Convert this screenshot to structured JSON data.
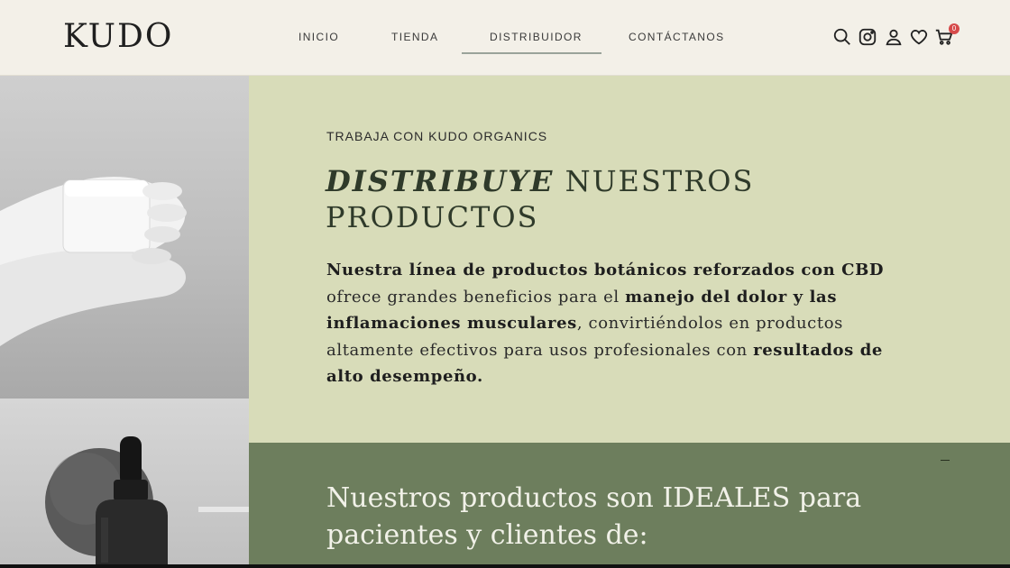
{
  "header": {
    "logo": "KUDO",
    "nav": [
      {
        "label": "INICIO"
      },
      {
        "label": "TIENDA"
      },
      {
        "label": "DISTRIBUIDOR"
      },
      {
        "label": "CONTÁCTANOS"
      }
    ],
    "icons": [
      "search-icon",
      "instagram-icon",
      "user-icon",
      "heart-icon",
      "cart-icon"
    ],
    "cart_count": "0"
  },
  "hero": {
    "eyebrow": "TRABAJA CON KUDO ORGANICS",
    "headline_em": "DISTRIBUYE",
    "headline_rest": " NUESTROS PRODUCTOS",
    "body": [
      {
        "text": "Nuestra línea de productos botánicos reforzados con CBD",
        "bold": true
      },
      {
        "text": " ofrece grandes beneficios para el ",
        "bold": false
      },
      {
        "text": "manejo del dolor y las inflamaciones musculares",
        "bold": true
      },
      {
        "text": ", convirtiéndolos en productos altamente efectivos para usos profesionales con ",
        "bold": false
      },
      {
        "text": "resultados de alto desempeño.",
        "bold": true
      }
    ]
  },
  "section2": {
    "heading": "Nuestros productos son IDEALES para pacientes y clientes de:"
  },
  "colors": {
    "background": "#f3f0e8",
    "panel_light": "#d8dcb9",
    "panel_dark": "#6d7e5d",
    "badge": "#d64a4a"
  }
}
